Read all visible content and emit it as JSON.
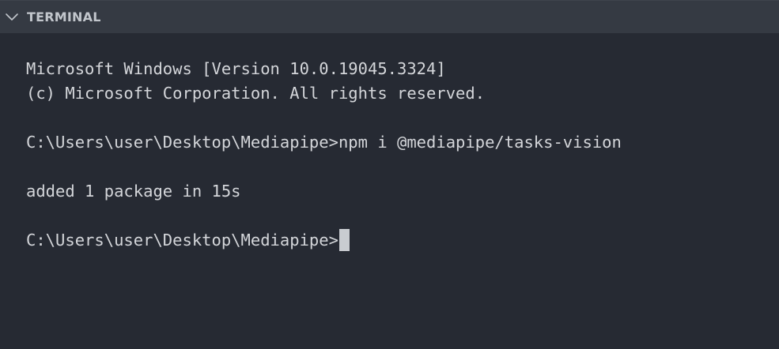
{
  "panel": {
    "title": "TERMINAL",
    "collapse_icon": "chevron-down-icon"
  },
  "terminal": {
    "lines": [
      "Microsoft Windows [Version 10.0.19045.3324]",
      "(c) Microsoft Corporation. All rights reserved.",
      "C:\\Users\\user\\Desktop\\Mediapipe>npm i @mediapipe/tasks-vision",
      "added 1 package in 15s"
    ],
    "prompt": "C:\\Users\\user\\Desktop\\Mediapipe>"
  },
  "colors": {
    "background": "#262a33",
    "header_background": "#353a43",
    "text": "#d4d6da",
    "header_text": "#c2c6cc",
    "cursor": "#c9ccd1"
  }
}
